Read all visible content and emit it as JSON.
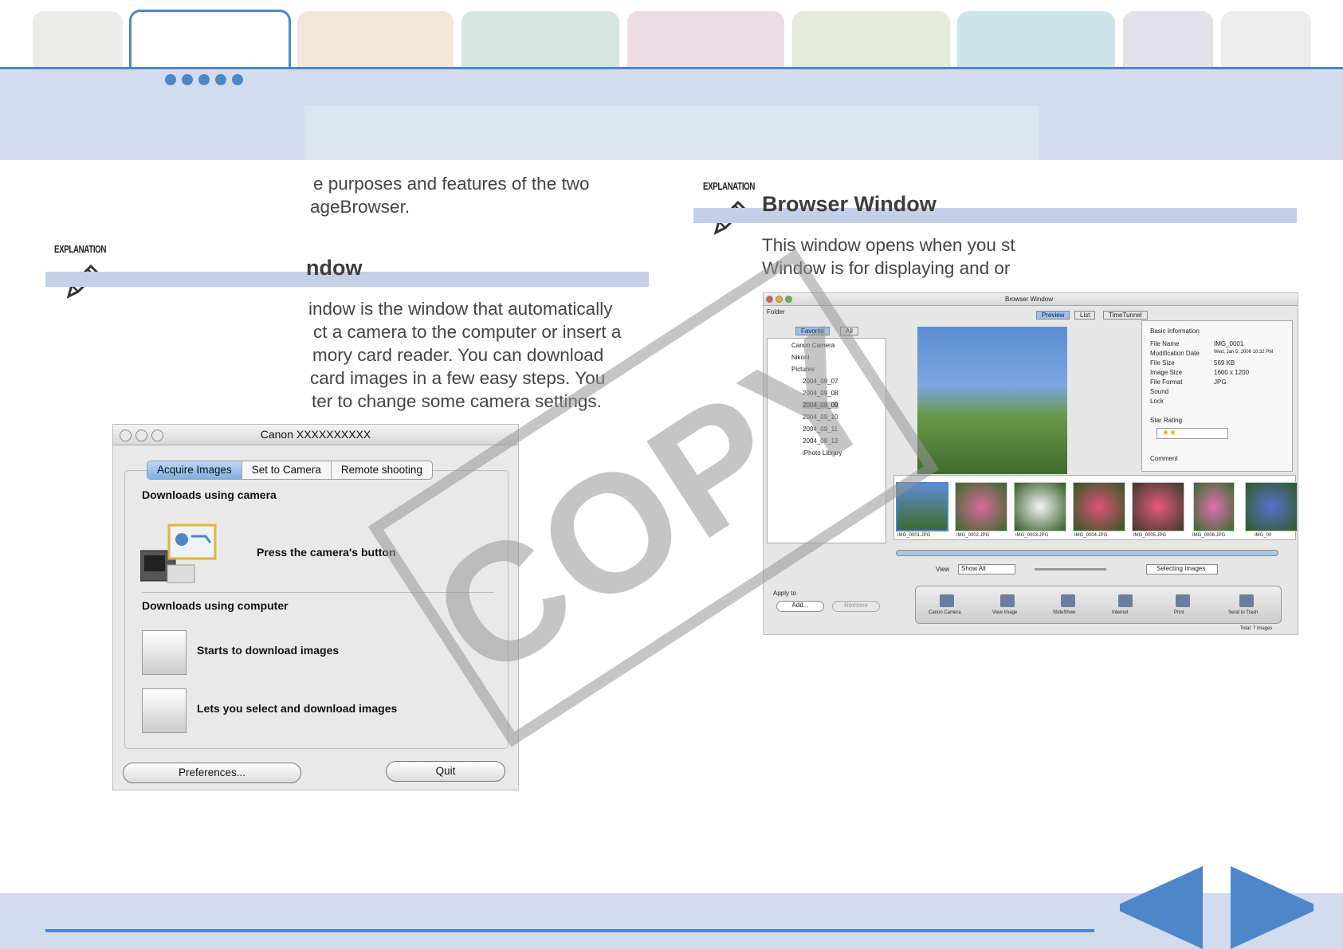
{
  "colors": {
    "accent": "#4d87c9",
    "band": "#d2dcee",
    "heading_bar": "#c4d0e9",
    "tab_colors": [
      "#ebebe9",
      "#ffffff",
      "#f2e6d8",
      "#d5e5e0",
      "#ecdde4",
      "#e4ebda",
      "#cce3ea",
      "#e2e0ea",
      "#ececec"
    ]
  },
  "left_section": {
    "intro_lines": [
      "e purposes and features of the two",
      "ageBrowser."
    ],
    "explanation_tag": "EXPLANATION",
    "heading": "ndow",
    "body_lines": [
      "indow is the window that automatically",
      "ct a camera to the computer or insert a",
      "mory card reader. You can download",
      "card images in a few easy steps. You",
      "ter to change some camera settings."
    ]
  },
  "right_section": {
    "explanation_tag": "EXPLANATION",
    "heading": "Browser Window",
    "body_lines": [
      "This window opens when you st",
      "Window is for displaying and or"
    ]
  },
  "canon_window": {
    "title": "Canon XXXXXXXXXX",
    "tabs": [
      "Acquire Images",
      "Set to Camera",
      "Remote shooting"
    ],
    "section1_label": "Downloads using camera",
    "camera_button_text": "Press the camera's button",
    "section2_label": "Downloads using computer",
    "option1": "Starts to download images",
    "option2": "Lets you select and download images",
    "preferences_button": "Preferences...",
    "quit_button": "Quit"
  },
  "browser_window": {
    "title": "Browser Window",
    "folder_label": "Folder",
    "folder_tabs": [
      "Favorite",
      "All"
    ],
    "view_tabs": [
      "Preview",
      "List",
      "TimeTunnel"
    ],
    "tree_items": [
      "Canon Camera",
      "Nikonl",
      "Pictures",
      "2004_09_07",
      "2004_09_08",
      "2004_09_09",
      "2004_09_10",
      "2004_09_11",
      "2004_09_12",
      "iPhoto Library"
    ],
    "info_header": "Basic Information",
    "info_rows": [
      [
        "File Name",
        "IMG_0001"
      ],
      [
        "Modification Date",
        "Wed, Jan 5, 2006 10:32 PM"
      ],
      [
        "File Size",
        "569 KB"
      ],
      [
        "Image Size",
        "1600 x 1200"
      ],
      [
        "File Format",
        "JPG"
      ],
      [
        "Sound",
        ""
      ],
      [
        "Lock",
        ""
      ]
    ],
    "star_rating_label": "Star Rating",
    "comment_label": "Comment",
    "thumb_labels": [
      "IMG_0001.JPG",
      "IMG_0002.JPG",
      "IMG_0003.JPG",
      "IMG_0004.JPG",
      "IMG_0005.JPG",
      "IMG_0006.JPG",
      "IMG_00"
    ],
    "view_label": "View",
    "view_select": "Show All",
    "selecting_images": "Selecting Images",
    "apply_label": "Apply to",
    "add_button": "Add...",
    "remove_button": "Remove",
    "toolbar_items": [
      "Canon Camera",
      "View Image",
      "SlideShow",
      "Internet",
      "Print",
      "Send to Trash"
    ],
    "total": "Total: 7 images"
  },
  "watermark": "COPY"
}
